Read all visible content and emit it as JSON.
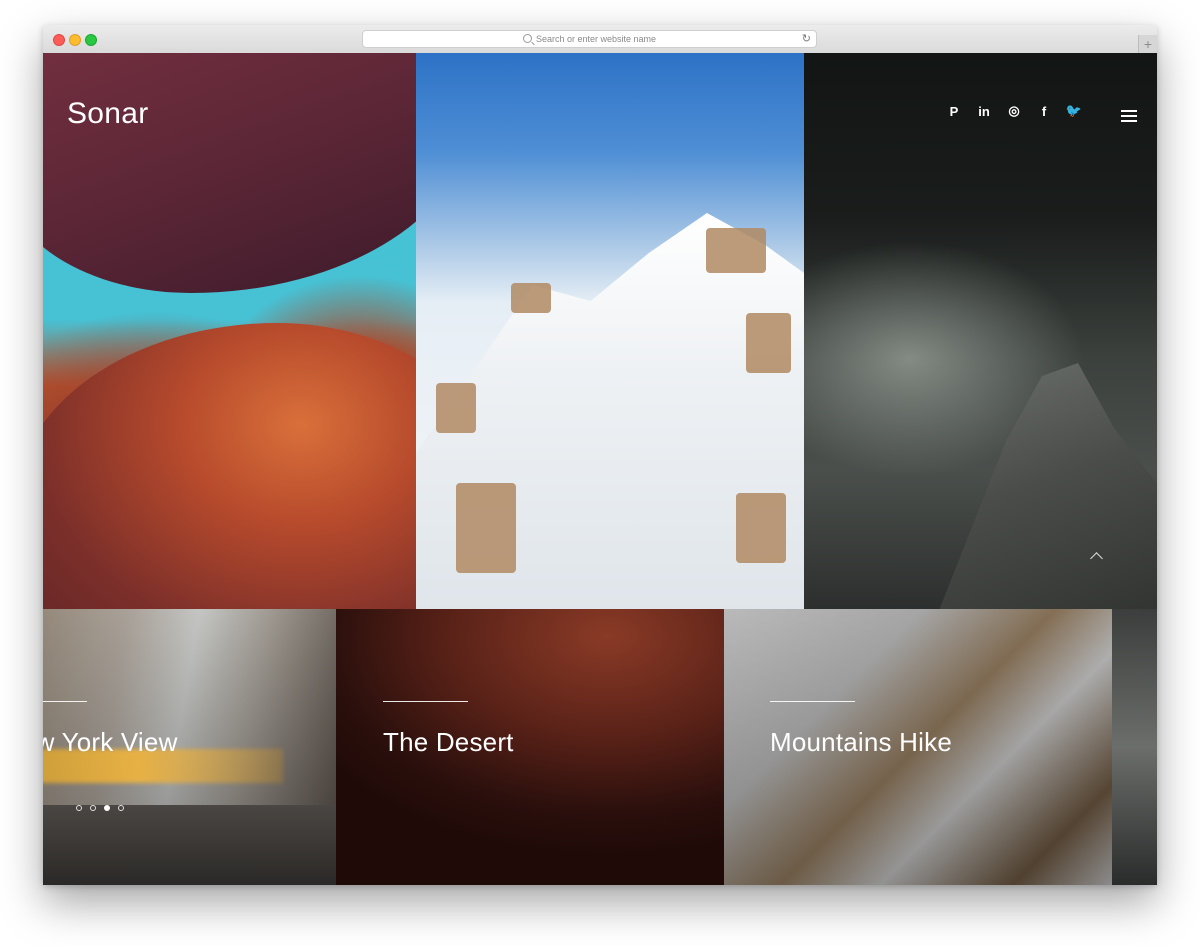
{
  "browser": {
    "address_placeholder": "Search or enter website name",
    "reload_glyph": "↻",
    "newtab_glyph": "+"
  },
  "site": {
    "logo": "Sonar",
    "socials": [
      {
        "name": "pinterest-icon",
        "glyph": "P"
      },
      {
        "name": "linkedin-icon",
        "glyph": "in"
      },
      {
        "name": "instagram-icon",
        "glyph": "◎"
      },
      {
        "name": "facebook-icon",
        "glyph": "f"
      },
      {
        "name": "twitter-icon",
        "glyph": "🐦"
      }
    ]
  },
  "cards": [
    {
      "title": "New York View"
    },
    {
      "title": "The Desert"
    },
    {
      "title": "Mountains Hike"
    }
  ],
  "pagination": {
    "count": 4,
    "active_index": 2
  },
  "colors": {
    "text_on_image": "#ffffff"
  }
}
